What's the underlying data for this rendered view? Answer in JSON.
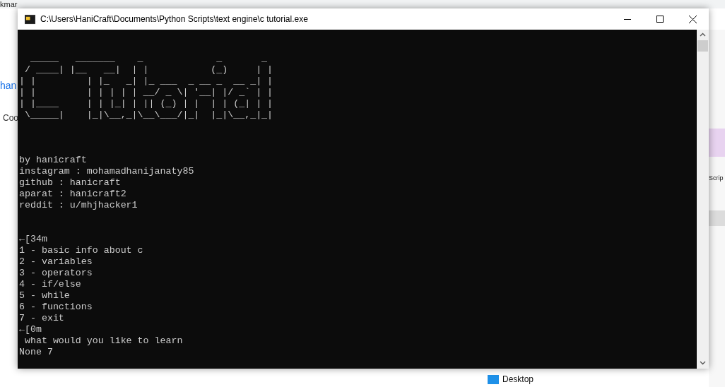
{
  "background": {
    "top_text": "kmar",
    "left_texts": [
      "han",
      "Coo"
    ],
    "right_text": "Scrip",
    "bottom_text": "Desktop"
  },
  "window": {
    "title": "C:\\Users\\HaniCraft\\Documents\\Python Scripts\\text engine\\c tutorial.exe"
  },
  "console": {
    "banner": [
      "  _____   _______    _             _       _ ",
      " / ____| |__   __|  | |           (_)     | |",
      "| |         | |_   _| |_ ___  _ __ _  __ _| |",
      "| |         | | | | | __/ _ \\| '__| |/ _` | |",
      "| |____     | | |_| | || (_) | |  | | (_| | |",
      " \\_____|    |_|\\__,_|\\__\\___/|_|  |_|\\__,_|_|"
    ],
    "credits": [
      "by hanicraft",
      "instagram : mohamadhanijanaty85",
      "github : hanicraft",
      "aparat : hanicraft2",
      "reddit : u/mhjhacker1"
    ],
    "menu_start": "←[34m",
    "menu": [
      "1 - basic info about c",
      "2 - variables",
      "3 - operators",
      "4 - if/else",
      "5 - while",
      "6 - functions",
      "7 - exit"
    ],
    "menu_end": "←[0m",
    "prompt": " what would you like to learn",
    "input": "None 7"
  }
}
